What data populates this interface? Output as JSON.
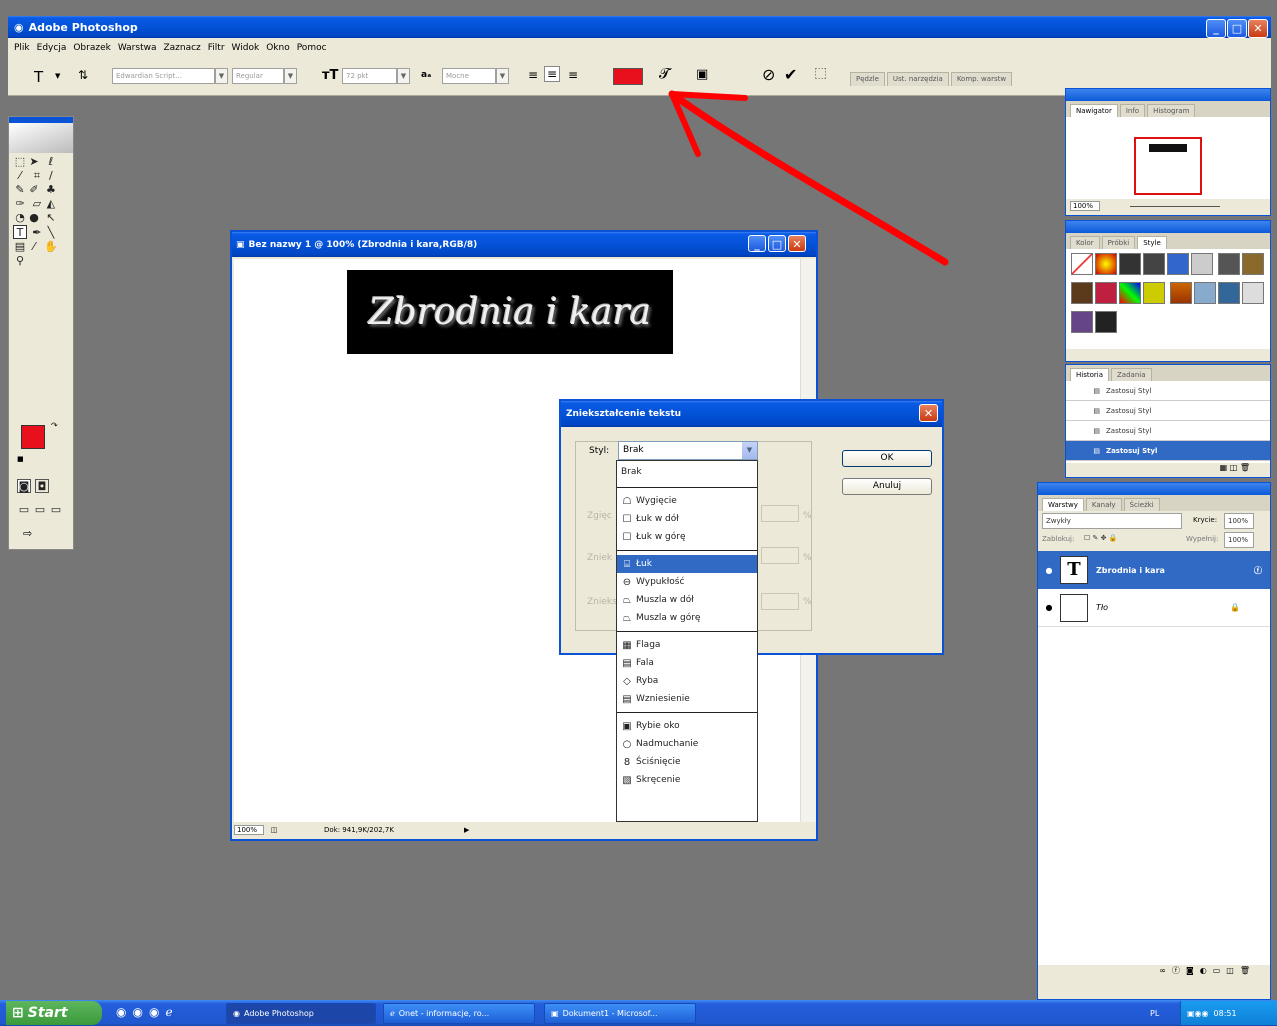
{
  "app": {
    "title": "Adobe Photoshop"
  },
  "menu": [
    "Plik",
    "Edycja",
    "Obrazek",
    "Warstwa",
    "Zaznacz",
    "Filtr",
    "Widok",
    "Okno",
    "Pomoc"
  ],
  "options": {
    "tool_glyph": "T",
    "font_family": "Edwardian Script...",
    "font_style": "Regular",
    "font_size": "72 pkt",
    "aa_label": "aₐ",
    "aa_method": "Mocne",
    "text_color": "#e8101c",
    "wells": [
      "Pędzle",
      "Ust. narzędzia",
      "Komp. warstw"
    ]
  },
  "document": {
    "title": "Bez nazwy 1 @ 100% (Zbrodnia i kara,RGB/8)",
    "text": "Zbrodnia i kara",
    "zoom": "100%",
    "doc_info": "Dok: 941,9K/202,7K"
  },
  "dialog": {
    "title": "Zniekształcenie tekstu",
    "style_label": "Styl:",
    "style_value": "Brak",
    "ok": "OK",
    "cancel": "Anuluj",
    "bg_labels": [
      "Zgięc",
      "Zniek",
      "Znieks"
    ],
    "pct": "%"
  },
  "warp_styles": {
    "group0": [
      {
        "label": "Brak",
        "icon": ""
      }
    ],
    "group1": [
      {
        "label": "Wygięcie",
        "icon": "☖"
      },
      {
        "label": "Łuk w dół",
        "icon": "☐"
      },
      {
        "label": "Łuk w górę",
        "icon": "☐"
      }
    ],
    "group2": [
      {
        "label": "Łuk",
        "icon": "⌸"
      },
      {
        "label": "Wypukłość",
        "icon": "⊖"
      },
      {
        "label": "Muszla w dół",
        "icon": "⏢"
      },
      {
        "label": "Muszla w górę",
        "icon": "⏢"
      }
    ],
    "group3": [
      {
        "label": "Flaga",
        "icon": "▦"
      },
      {
        "label": "Fala",
        "icon": "▤"
      },
      {
        "label": "Ryba",
        "icon": "◇"
      },
      {
        "label": "Wzniesienie",
        "icon": "▤"
      }
    ],
    "group4": [
      {
        "label": "Rybie oko",
        "icon": "▣"
      },
      {
        "label": "Nadmuchanie",
        "icon": "○"
      },
      {
        "label": "Ściśnięcie",
        "icon": "8"
      },
      {
        "label": "Skręcenie",
        "icon": "▧"
      }
    ]
  },
  "navigator": {
    "tabs": [
      "Nawigator",
      "Info",
      "Histogram"
    ],
    "zoom": "100%"
  },
  "styles_palette": {
    "tabs": [
      "Kolor",
      "Próbki",
      "Style"
    ]
  },
  "history": {
    "tabs": [
      "Historia",
      "Zadania"
    ],
    "items": [
      "Zastosuj Styl",
      "Zastosuj Styl",
      "Zastosuj Styl",
      "Zastosuj Styl"
    ]
  },
  "layers": {
    "tabs": [
      "Warstwy",
      "Kanały",
      "Ścieżki"
    ],
    "blend": "Zwykły",
    "opacity_label": "Krycie:",
    "opacity": "100%",
    "lock_label": "Zablokuj:",
    "fill_label": "Wypełnij:",
    "fill": "100%",
    "items": [
      {
        "name": "Zbrodnia i kara",
        "thumb": "T"
      },
      {
        "name": "Tło",
        "thumb": ""
      }
    ]
  },
  "taskbar": {
    "start": "Start",
    "tasks": [
      "Adobe Photoshop",
      "Onet - informacje, ro...",
      "Dokument1 - Microsof..."
    ],
    "lang": "PL",
    "clock": "08:51"
  },
  "colors": {
    "accent": "#0a52d6",
    "arrow": "#ff0000",
    "foreground": "#e8101c"
  }
}
